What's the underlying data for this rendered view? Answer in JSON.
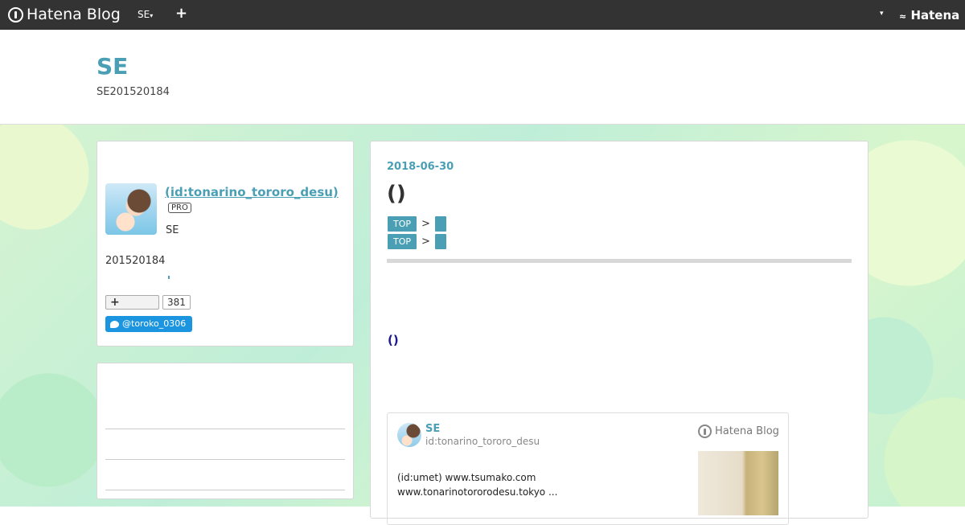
{
  "topbar": {
    "logo_text": "Hatena Blog",
    "blog_selector": "SE",
    "add_label": "+",
    "right_caret": "▾",
    "hatena_label": "Hatena"
  },
  "header": {
    "title": "SE",
    "description": "SE201520184"
  },
  "profile": {
    "name": " (id:tonarino_tororo_desu)",
    "badge": "PRO",
    "tagline": "SE",
    "description": "201520184",
    "readers_button": "+",
    "readers_count": "381",
    "twitter_label": "@toroko_0306"
  },
  "post": {
    "date": "2018-06-30",
    "title": "()",
    "breadcrumbs": [
      {
        "top": "TOP",
        "sep": ">"
      },
      {
        "top": "TOP",
        "sep": ">"
      }
    ],
    "body_link": "()"
  },
  "embed": {
    "author": "SE",
    "author_id": "id:tonarino_tororo_desu",
    "brand": "Hatena Blog",
    "text": "(id:umet) www.tsumako.com www.tonarinotororodesu.tokyo ..."
  }
}
